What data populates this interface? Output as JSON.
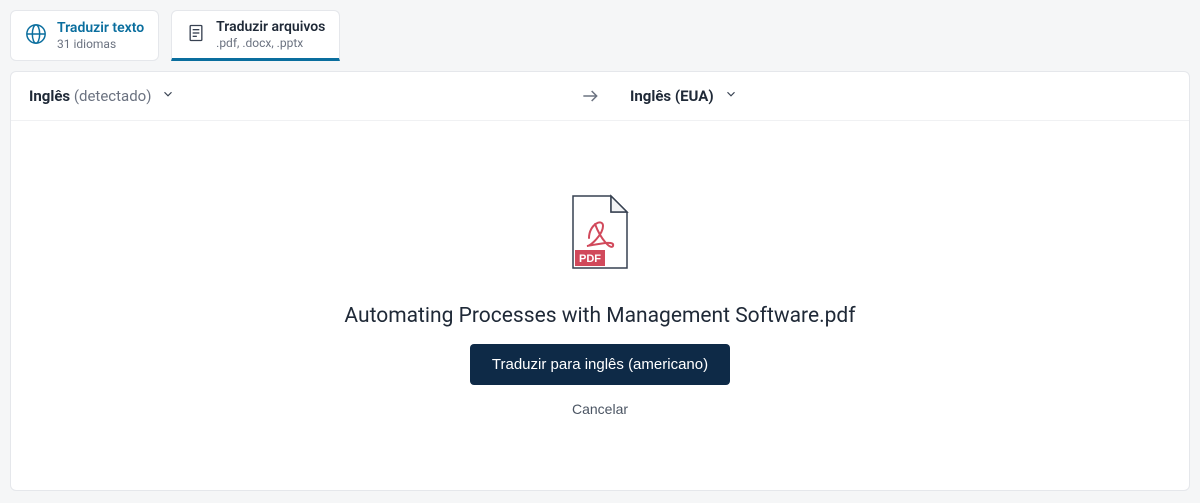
{
  "tabs": {
    "text": {
      "title": "Traduzir texto",
      "subtitle": "31 idiomas"
    },
    "files": {
      "title": "Traduzir arquivos",
      "subtitle": ".pdf, .docx, .pptx"
    }
  },
  "langBar": {
    "sourceLabel": "Inglês",
    "sourceDetected": " (detectado)",
    "targetLabel": "Inglês (EUA)"
  },
  "file": {
    "name": "Automating Processes with Management Software.pdf",
    "badge": "PDF"
  },
  "actions": {
    "translate": "Traduzir para inglês (americano)",
    "cancel": "Cancelar"
  }
}
